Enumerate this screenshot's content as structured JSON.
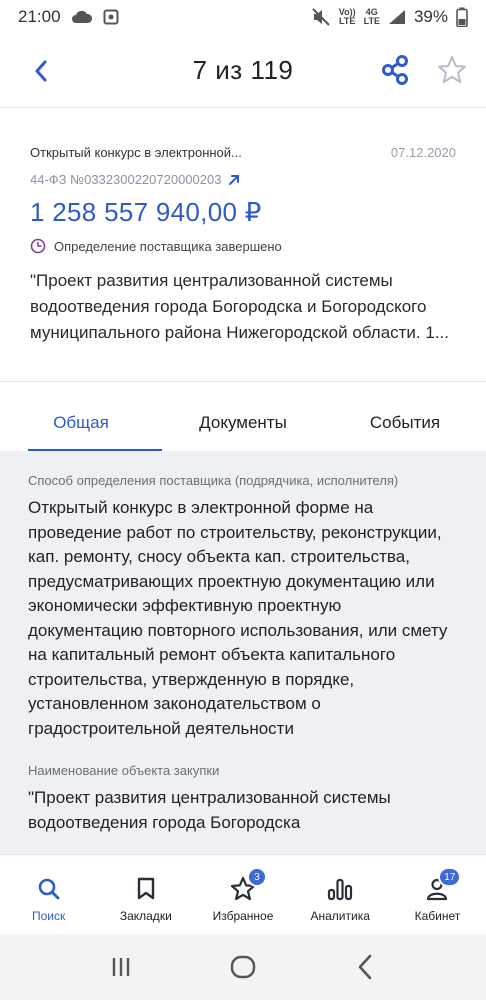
{
  "status_bar": {
    "time": "21:00",
    "battery": "39%",
    "network_top": "Vo))",
    "network_bottom": "LTE",
    "signal_top": "4G",
    "signal_bottom": "LTE"
  },
  "nav": {
    "title": "7 из 119"
  },
  "card": {
    "type": "Открытый конкурс в электронной...",
    "date": "07.12.2020",
    "number": "44-ФЗ №0332300220720000203",
    "price": "1 258 557 940,00 ₽",
    "status": "Определение поставщика завершено",
    "description": "\"Проект развития централизованной системы водоотведения города Богородска и  Богородского муниципального района Нижегородской области. 1..."
  },
  "tabs": [
    {
      "label": "Общая",
      "active": true
    },
    {
      "label": "Документы",
      "active": false
    },
    {
      "label": "События",
      "active": false
    }
  ],
  "content": {
    "fields": [
      {
        "label": "Способ определения поставщика (подрядчика, исполнителя)",
        "value": "Открытый конкурс в электронной форме на проведение работ по строительству, реконструкции, кап. ремонту, сносу объекта кап. строительства, предусматривающих проектную документацию или экономически эффективную проектную документацию повторного использования, или смету на капитальный ремонт объекта капитального строительства, утвержденную в порядке, установленном законодательством о градостроительной деятельности"
      },
      {
        "label": "Наименование объекта закупки",
        "value": "\"Проект развития централизованной системы водоотведения города Богородска"
      }
    ]
  },
  "bottom_nav": [
    {
      "label": "Поиск",
      "icon": "search-icon",
      "active": true
    },
    {
      "label": "Закладки",
      "icon": "bookmark-icon",
      "active": false
    },
    {
      "label": "Избранное",
      "icon": "star-icon",
      "active": false,
      "badge": "3"
    },
    {
      "label": "Аналитика",
      "icon": "analytics-icon",
      "active": false
    },
    {
      "label": "Кабинет",
      "icon": "user-icon",
      "active": false,
      "badge": "17"
    }
  ],
  "colors": {
    "accent": "#2f5bc8",
    "content_bg": "#eef0f4",
    "badge": "#3f68d8"
  }
}
